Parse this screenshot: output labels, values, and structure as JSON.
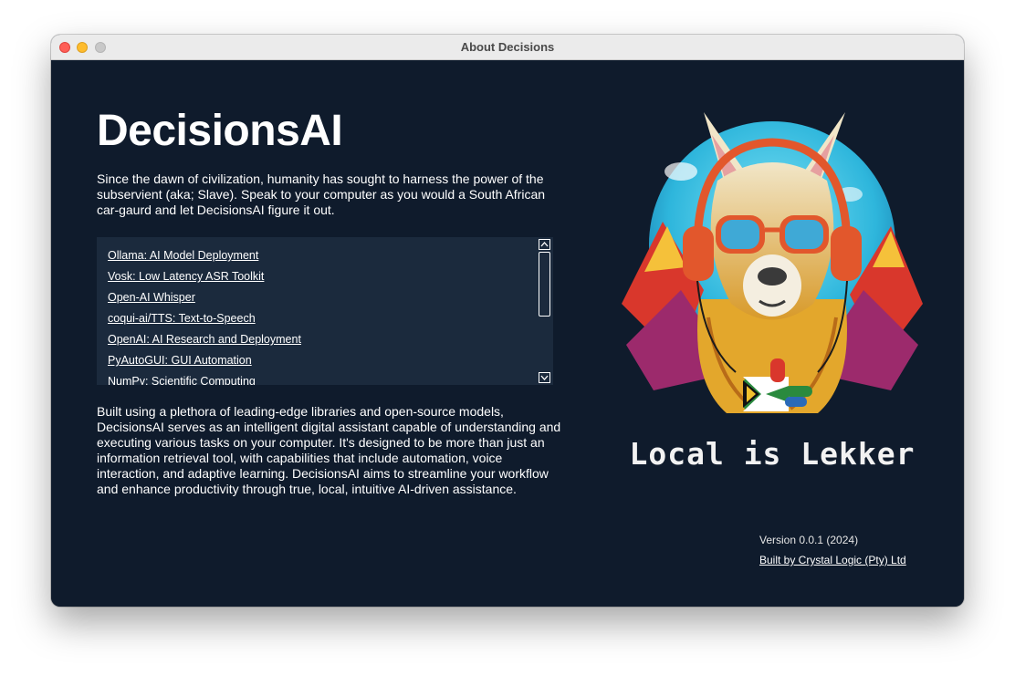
{
  "window": {
    "title": "About Decisions"
  },
  "app": {
    "name": "DecisionsAI",
    "intro": "Since the dawn of civilization, humanity has sought to harness the power of the subservient (aka; Slave). Speak to your computer as you would a South African car-gaurd and let DecisionsAI figure it out.",
    "description": "Built using a plethora of leading-edge libraries and open-source models, DecisionsAI serves as an intelligent digital assistant capable of understanding and executing various tasks on your computer. It's designed to be more than just an information retrieval tool, with capabilities that include automation, voice interaction, and adaptive learning. DecisionsAI aims to streamline your workflow and enhance productivity through true, local, intuitive AI-driven assistance.",
    "tagline": "Local is Lekker",
    "version": "Version 0.0.1 (2024)",
    "built_by": "Built by Crystal Logic (Pty) Ltd"
  },
  "links": [
    {
      "label": "Ollama: AI Model Deployment"
    },
    {
      "label": "Vosk: Low Latency ASR Toolkit"
    },
    {
      "label": "Open-AI Whisper"
    },
    {
      "label": "coqui-ai/TTS: Text-to-Speech"
    },
    {
      "label": "OpenAI: AI Research and Deployment"
    },
    {
      "label": "PyAutoGUI: GUI Automation"
    },
    {
      "label": "NumPy: Scientific Computing"
    }
  ],
  "icons": {
    "scroll_up": "chevron-up-icon",
    "scroll_down": "chevron-down-icon",
    "mascot": "llama-mascot-icon"
  },
  "colors": {
    "background": "#0f1b2c",
    "panel": "#1b2a3d",
    "text": "#ffffff"
  }
}
